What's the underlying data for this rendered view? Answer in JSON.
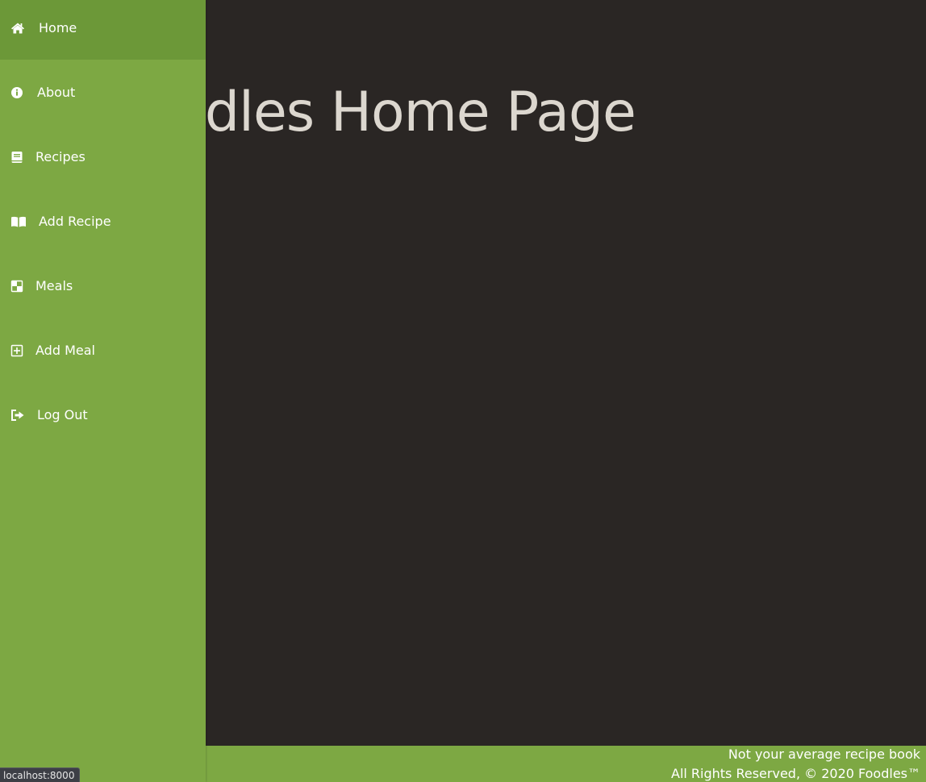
{
  "main": {
    "title": "Foodles Home Page"
  },
  "sidebar": {
    "items": [
      {
        "label": "Home",
        "icon": "home-icon",
        "active": true
      },
      {
        "label": "About",
        "icon": "info-circle-icon",
        "active": false
      },
      {
        "label": "Recipes",
        "icon": "book-icon",
        "active": false
      },
      {
        "label": "Add Recipe",
        "icon": "open-book-icon",
        "active": false
      },
      {
        "label": "Meals",
        "icon": "checkerboard-icon",
        "active": false
      },
      {
        "label": "Add Meal",
        "icon": "plus-square-icon",
        "active": false
      },
      {
        "label": "Log Out",
        "icon": "sign-out-icon",
        "active": false
      }
    ]
  },
  "footer": {
    "tagline": "Not your average recipe book",
    "copyright": "All Rights Reserved, © 2020 Foodles™"
  },
  "status_bar": {
    "url": "localhost:8000"
  },
  "colors": {
    "sidebar": "#7da843",
    "sidebar_active": "#6c9838",
    "background": "#2a2624",
    "title": "#dcd7cf"
  }
}
